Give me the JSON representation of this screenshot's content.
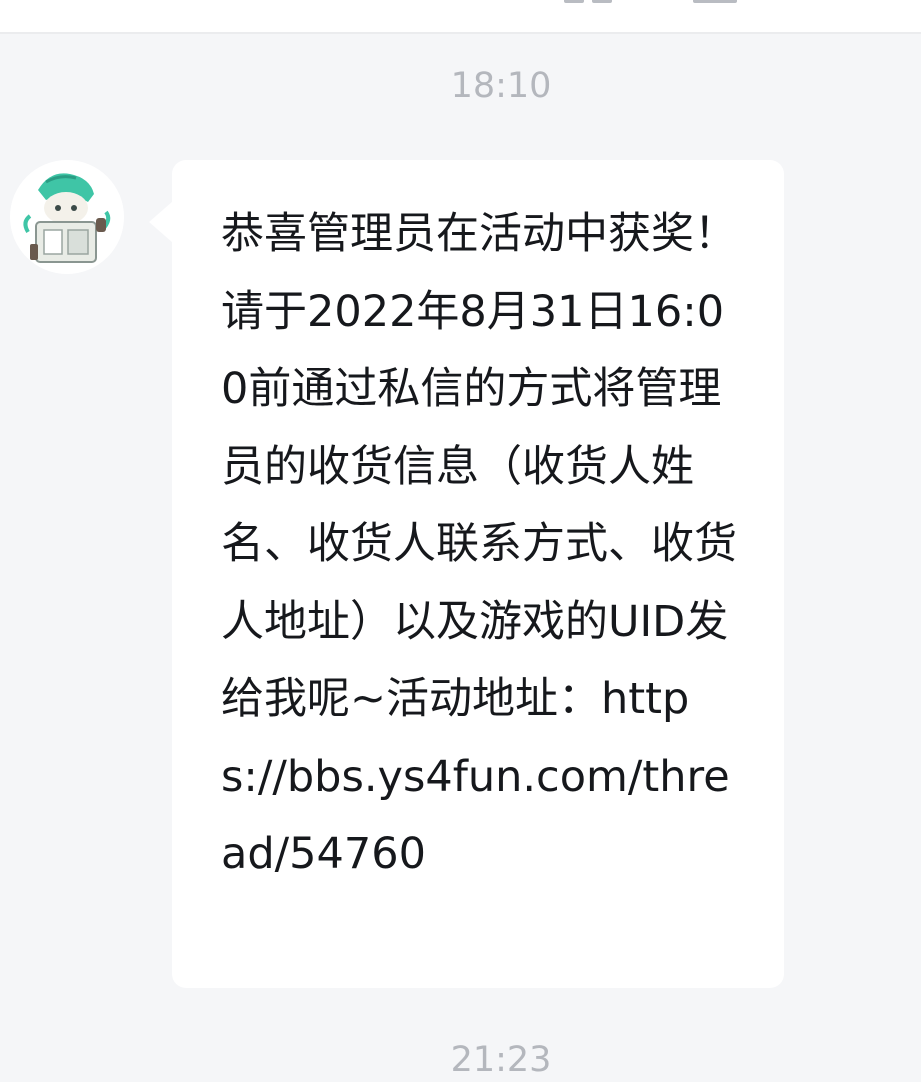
{
  "header": {
    "icons": [
      "window-icon",
      "list-icon"
    ]
  },
  "conversation": {
    "timestamps": [
      "18:10",
      "21:23"
    ],
    "messages": [
      {
        "sender_avatar": "anime-character-avatar",
        "text": "恭喜管理员在活动中获奖！请于2022年8月31日16:00前通过私信的方式将管理员的收货信息（收货人姓名、收货人联系方式、收货人地址）以及游戏的UID发给我呢~活动地址：https://bbs.ys4fun.com/thread/54760"
      }
    ]
  },
  "colors": {
    "background": "#f5f6f8",
    "bubble": "#ffffff",
    "text": "#16181c",
    "timestamp": "#b4b7bd",
    "avatar_accent": "#3fc5a6"
  }
}
